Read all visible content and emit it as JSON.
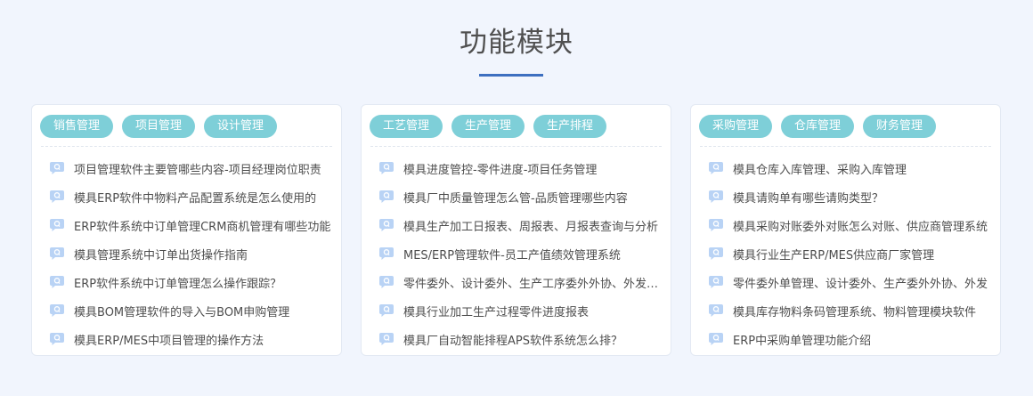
{
  "section": {
    "title": "功能模块",
    "accent_color": "#3d6fc0",
    "tab_color": "#7ecfd8",
    "item_icon": "question-bubble-icon"
  },
  "cards": [
    {
      "tabs": [
        "销售管理",
        "项目管理",
        "设计管理"
      ],
      "items": [
        "项目管理软件主要管哪些内容-项目经理岗位职责",
        "模具ERP软件中物料产品配置系统是怎么使用的",
        "ERP软件系统中订单管理CRM商机管理有哪些功能",
        "模具管理系统中订单出货操作指南",
        "ERP软件系统中订单管理怎么操作跟踪？",
        "模具BOM管理软件的导入与BOM申购管理",
        "模具ERP/MES中项目管理的操作方法"
      ]
    },
    {
      "tabs": [
        "工艺管理",
        "生产管理",
        "生产排程"
      ],
      "items": [
        "模具进度管控-零件进度-项目任务管理",
        "模具厂中质量管理怎么管-品质管理哪些内容",
        "模具生产加工日报表、周报表、月报表查询与分析",
        "MES/ERP管理软件-员工产值绩效管理系统",
        "零件委外、设计委外、生产工序委外外协、外发加工",
        "模具行业加工生产过程零件进度报表",
        "模具厂自动智能排程APS软件系统怎么排？"
      ]
    },
    {
      "tabs": [
        "采购管理",
        "仓库管理",
        "财务管理"
      ],
      "items": [
        "模具仓库入库管理、采购入库管理",
        "模具请购单有哪些请购类型？",
        "模具采购对账委外对账怎么对账、供应商管理系统",
        "模具行业生产ERP/MES供应商厂家管理",
        "零件委外单管理、设计委外、生产委外外协、外发",
        "模具库存物料条码管理系统、物料管理模块软件",
        "ERP中采购单管理功能介绍"
      ]
    }
  ]
}
